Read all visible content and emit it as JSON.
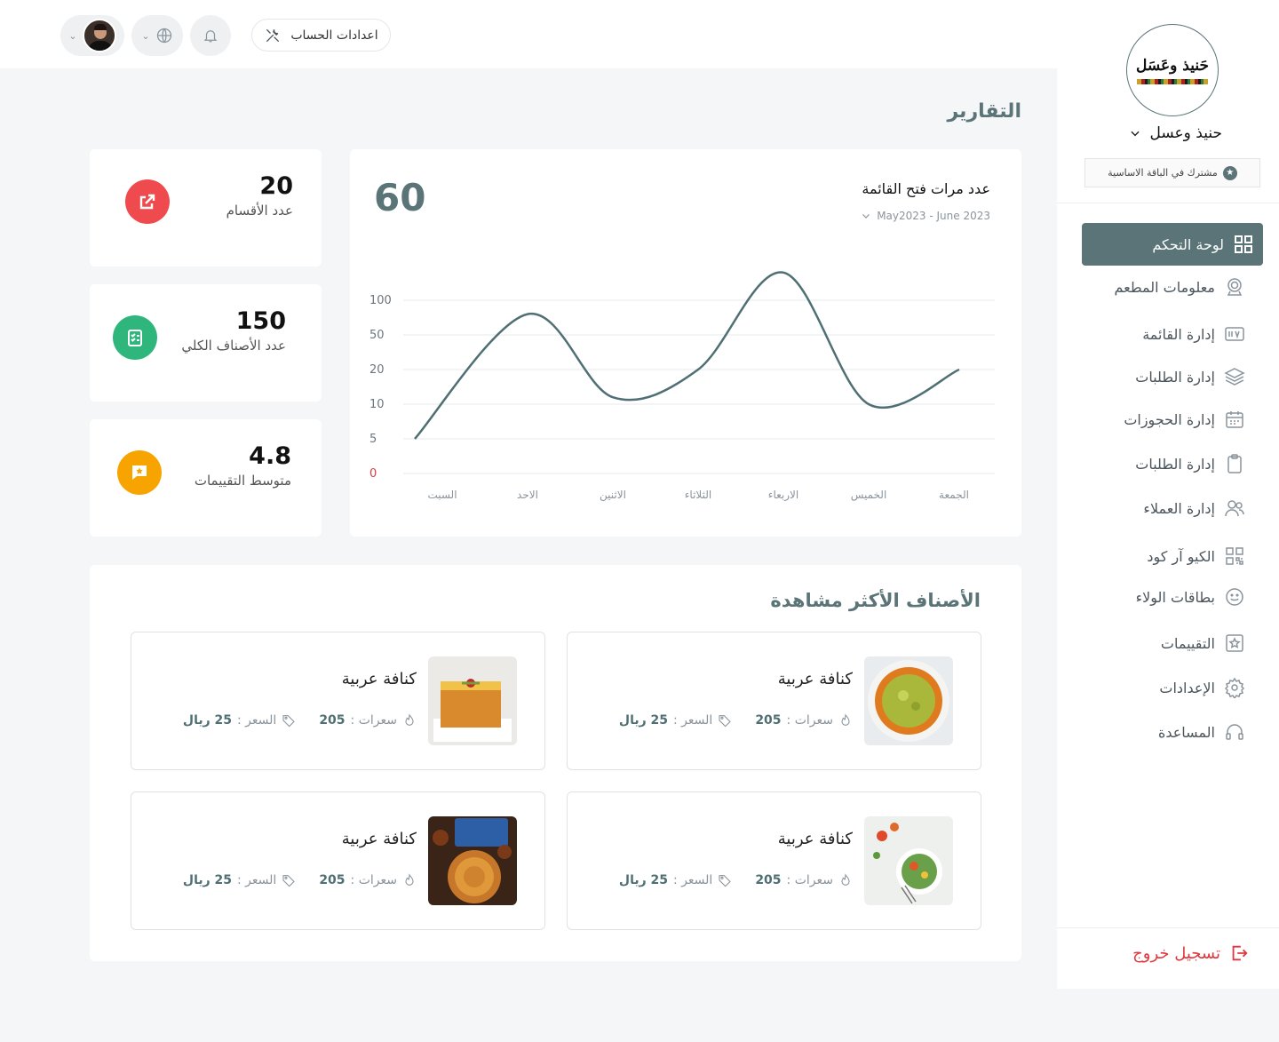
{
  "header": {
    "account_settings_label": "اعدادات الحساب"
  },
  "sidebar": {
    "logo_text": "حَنيذ وعَسَل",
    "store_name": "حنيذ وعسل",
    "plan_label": "مشترك في الباقة الاساسية",
    "items": [
      {
        "label": "لوحة التحكم",
        "icon": "dashboard-icon",
        "active": true
      },
      {
        "label": "معلومات المطعم",
        "icon": "restaurant-icon"
      },
      {
        "label": "إدارة القائمة",
        "icon": "menu-icon"
      },
      {
        "label": "إدارة الطلبات",
        "icon": "layers-icon"
      },
      {
        "label": "إدارة الحجوزات",
        "icon": "calendar-icon"
      },
      {
        "label": "إدارة الطلبات",
        "icon": "clipboard-icon"
      },
      {
        "label": "إدارة العملاء",
        "icon": "users-icon"
      },
      {
        "label": "الكيو آر كود",
        "icon": "qr-icon"
      },
      {
        "label": "بطاقات الولاء",
        "icon": "smile-icon"
      },
      {
        "label": "التقييمات",
        "icon": "star-icon"
      },
      {
        "label": "الإعدادات",
        "icon": "gear-icon"
      },
      {
        "label": "المساعدة",
        "icon": "headset-icon"
      }
    ],
    "logout_label": "تسجيل خروج"
  },
  "page": {
    "title": "التقارير"
  },
  "stats": [
    {
      "value": "20",
      "label": "عدد الأقسام",
      "icon": "external-link-icon",
      "color": "#ef4b4f"
    },
    {
      "value": "150",
      "label": "عدد الأصناف الكلي",
      "icon": "checklist-icon",
      "color": "#2eb67d"
    },
    {
      "value": "4.8",
      "label": "متوسط التقييمات",
      "icon": "rating-icon",
      "color": "#f7a400"
    }
  ],
  "chart": {
    "title": "عدد مرات فتح القائمة",
    "range": "May2023 - June 2023",
    "total": "60"
  },
  "chart_data": {
    "type": "line",
    "categories": [
      "السبت",
      "الاحد",
      "الاثنين",
      "الثلاثاء",
      "الاربعاء",
      "الخميس",
      "الجمعة"
    ],
    "y_ticks": [
      "0",
      "5",
      "10",
      "20",
      "50",
      "100"
    ],
    "series": [
      {
        "values": [
          5,
          80,
          12,
          20,
          140,
          10,
          20
        ]
      }
    ],
    "ylim": [
      0,
      100
    ],
    "grid": true,
    "line_color": "#4f6f74"
  },
  "most_viewed": {
    "title": "الأصناف الأكثر مشاهدة",
    "items": [
      {
        "name": "كنافة عربية",
        "views_label": "سعرات :",
        "views": "205",
        "price_label": "السعر :",
        "price": "25 ريال",
        "image": "kunafa-round"
      },
      {
        "name": "كنافة عربية",
        "views_label": "سعرات :",
        "views": "205",
        "price_label": "السعر :",
        "price": "25 ريال",
        "image": "kunafa-square"
      },
      {
        "name": "كنافة عربية",
        "views_label": "سعرات :",
        "views": "205",
        "price_label": "السعر :",
        "price": "25 ريال",
        "image": "salad"
      },
      {
        "name": "كنافة عربية",
        "views_label": "سعرات :",
        "views": "205",
        "price_label": "السعر :",
        "price": "25 ريال",
        "image": "caramel-sweets"
      }
    ]
  }
}
